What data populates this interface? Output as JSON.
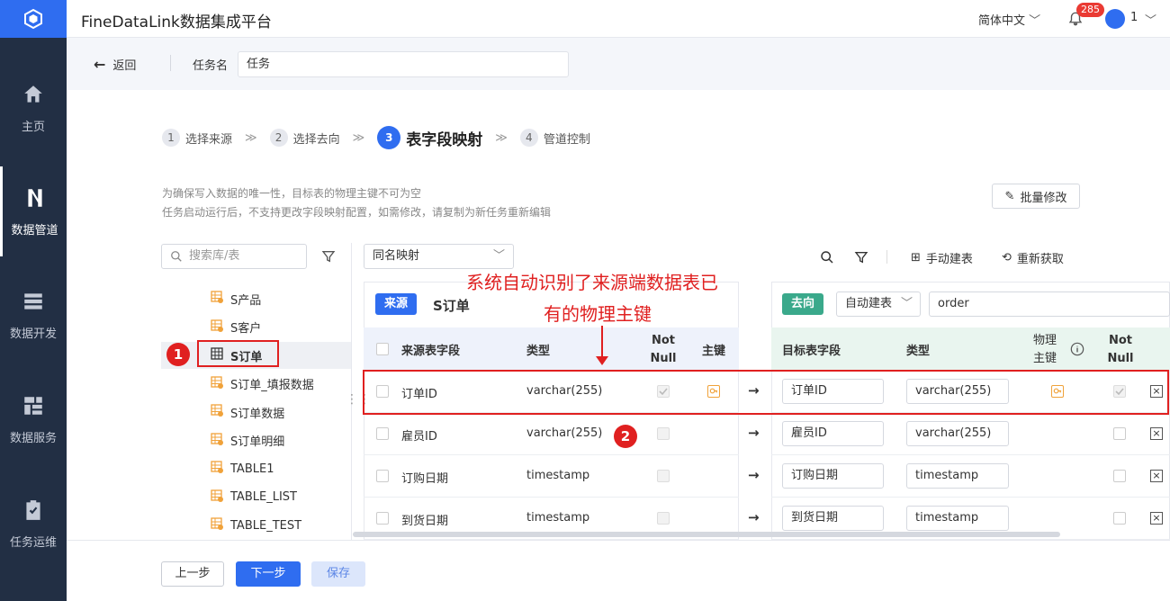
{
  "app": {
    "title": "FineDataLink数据集成平台",
    "language": "简体中文",
    "notification_count": "285",
    "user": "1"
  },
  "sidebar": {
    "items": [
      {
        "label": "主页",
        "icon": "home-icon"
      },
      {
        "label": "数据管道",
        "icon": "pipeline-icon",
        "active": true
      },
      {
        "label": "数据开发",
        "icon": "dev-icon"
      },
      {
        "label": "数据服务",
        "icon": "service-icon"
      },
      {
        "label": "任务运维",
        "icon": "ops-icon"
      }
    ]
  },
  "subheader": {
    "back_label": "返回",
    "task_name_label": "任务名",
    "task_name_value": "任务"
  },
  "steps": [
    {
      "num": "1",
      "label": "选择来源"
    },
    {
      "num": "2",
      "label": "选择去向"
    },
    {
      "num": "3",
      "label": "表字段映射",
      "active": true
    },
    {
      "num": "4",
      "label": "管道控制"
    }
  ],
  "tips": {
    "line1": "为确保写入数据的唯一性，目标表的物理主键不可为空",
    "line2": "任务启动运行后，不支持更改字段映射配置，如需修改，请复制为新任务重新编辑"
  },
  "batch_edit_label": "批量修改",
  "left_panel": {
    "search_placeholder": "搜索库/表",
    "tables": [
      "S产品",
      "S客户",
      "S订单",
      "S订单_填报数据",
      "S订单数据",
      "S订单明细",
      "TABLE1",
      "TABLE_LIST",
      "TABLE_TEST"
    ],
    "selected": "S订单"
  },
  "mapping": {
    "mode": "同名映射",
    "manual_create": "手动建表",
    "refetch": "重新获取"
  },
  "source": {
    "tag": "来源",
    "table": "S订单",
    "headers": {
      "field": "来源表字段",
      "type": "类型",
      "notnull": "Not Null",
      "pk": "主键"
    },
    "rows": [
      {
        "field": "订单ID",
        "type": "varchar(255)"
      },
      {
        "field": "雇员ID",
        "type": "varchar(255)"
      },
      {
        "field": "订购日期",
        "type": "timestamp"
      },
      {
        "field": "到货日期",
        "type": "timestamp"
      }
    ]
  },
  "target": {
    "tag": "去向",
    "create_mode": "自动建表",
    "table": "order",
    "headers": {
      "field": "目标表字段",
      "type": "类型",
      "pk_line1": "物理",
      "pk_line2": "主键",
      "notnull": "Not Null"
    },
    "rows": [
      {
        "field": "订单ID",
        "type": "varchar(255)"
      },
      {
        "field": "雇员ID",
        "type": "varchar(255)"
      },
      {
        "field": "订购日期",
        "type": "timestamp"
      },
      {
        "field": "到货日期",
        "type": "timestamp"
      }
    ]
  },
  "annotation": {
    "line1": "系统自动识别了来源端数据表已",
    "line2": "有的物理主键",
    "marker1": "1",
    "marker2": "2"
  },
  "footer": {
    "prev": "上一步",
    "next": "下一步",
    "save": "保存"
  },
  "colors": {
    "brand": "#2f6df0",
    "sidebar": "#222f44",
    "source_tag": "#2f6df0",
    "target_tag": "#3aa98b",
    "annotation": "#e02020"
  }
}
